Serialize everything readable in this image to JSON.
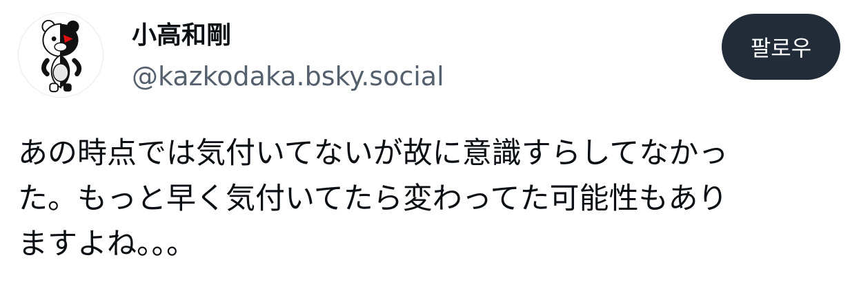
{
  "author": {
    "display_name": "小高和剛",
    "handle": "@kazkodaka.bsky.social",
    "avatar_icon": "bear-mascot-avatar-icon"
  },
  "actions": {
    "follow_label": "팔로우"
  },
  "post": {
    "lines": [
      "あの時点では気付いてないが故に意識すらしてなかっ",
      "た。もっと早く気付いてたら変わってた可能性もあり",
      "ますよね。。。"
    ]
  },
  "colors": {
    "text": "#0b0f14",
    "handle": "#55606e",
    "button_bg": "#222b38",
    "button_text": "#ffffff"
  }
}
